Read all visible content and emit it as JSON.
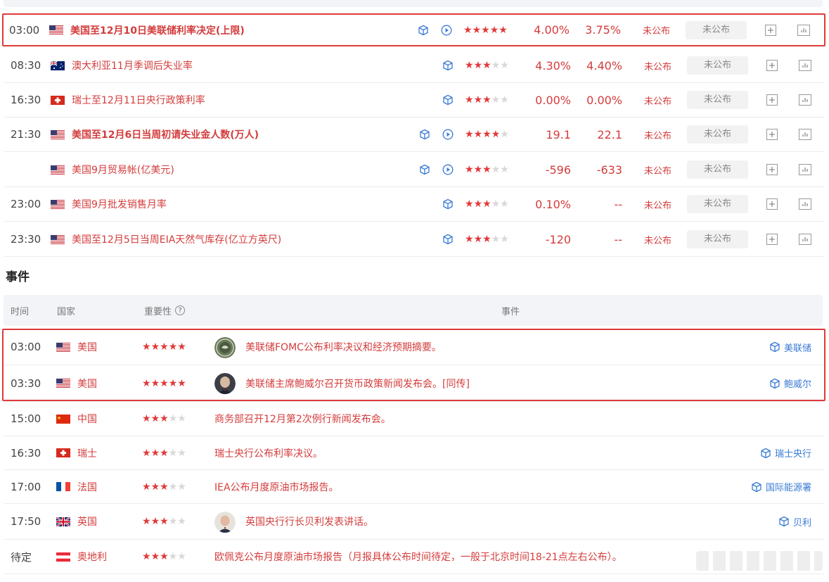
{
  "data_rows": [
    {
      "time": "03:00",
      "flag": "us",
      "name": "美国至12月10日美联储利率决定(上限)",
      "bold": true,
      "cube": true,
      "play": true,
      "stars": 5,
      "previous": "4.00%",
      "forecast": "3.75%",
      "status": "未公布",
      "actual": "未公布",
      "highlight": true
    },
    {
      "time": "08:30",
      "flag": "au",
      "name": "澳大利亚11月季调后失业率",
      "bold": false,
      "cube": true,
      "play": false,
      "stars": 3,
      "previous": "4.30%",
      "forecast": "4.40%",
      "status": "未公布",
      "actual": "未公布",
      "highlight": false
    },
    {
      "time": "16:30",
      "flag": "ch",
      "name": "瑞士至12月11日央行政策利率",
      "bold": false,
      "cube": true,
      "play": false,
      "stars": 3,
      "previous": "0.00%",
      "forecast": "0.00%",
      "status": "未公布",
      "actual": "未公布",
      "highlight": false
    },
    {
      "time": "21:30",
      "flag": "us",
      "name": "美国至12月6日当周初请失业金人数(万人)",
      "bold": true,
      "cube": true,
      "play": true,
      "stars": 4,
      "previous": "19.1",
      "forecast": "22.1",
      "status": "未公布",
      "actual": "未公布",
      "highlight": false
    },
    {
      "time": "",
      "flag": "us",
      "name": "美国9月贸易帐(亿美元)",
      "bold": false,
      "cube": true,
      "play": true,
      "stars": 3,
      "previous": "-596",
      "forecast": "-633",
      "status": "未公布",
      "actual": "未公布",
      "highlight": false
    },
    {
      "time": "23:00",
      "flag": "us",
      "name": "美国9月批发销售月率",
      "bold": false,
      "cube": true,
      "play": false,
      "stars": 3,
      "previous": "0.10%",
      "forecast": "--",
      "status": "未公布",
      "actual": "未公布",
      "highlight": false
    },
    {
      "time": "23:30",
      "flag": "us",
      "name": "美国至12月5日当周EIA天然气库存(亿立方英尺)",
      "bold": false,
      "cube": true,
      "play": false,
      "stars": 3,
      "previous": "-120",
      "forecast": "--",
      "status": "未公布",
      "actual": "未公布",
      "highlight": false
    }
  ],
  "events_section": {
    "title": "事件",
    "headers": {
      "time": "时间",
      "country": "国家",
      "importance": "重要性",
      "importance_help": "?",
      "event": "事件"
    }
  },
  "event_rows": [
    {
      "time": "03:00",
      "flag": "us",
      "country": "美国",
      "stars": 5,
      "avatar": "fed-seal",
      "text": "美联储FOMC公布利率决议和经济预期摘要。",
      "tag": "美联储"
    },
    {
      "time": "03:30",
      "flag": "us",
      "country": "美国",
      "stars": 5,
      "avatar": "powell",
      "text": "美联储主席鲍威尔召开货币政策新闻发布会。[同传]",
      "tag": "鲍威尔"
    },
    {
      "time": "15:00",
      "flag": "cn",
      "country": "中国",
      "stars": 3,
      "avatar": "",
      "text": "商务部召开12月第2次例行新闻发布会。",
      "tag": ""
    },
    {
      "time": "16:30",
      "flag": "ch",
      "country": "瑞士",
      "stars": 3,
      "avatar": "",
      "text": "瑞士央行公布利率决议。",
      "tag": "瑞士央行"
    },
    {
      "time": "17:00",
      "flag": "fr",
      "country": "法国",
      "stars": 3,
      "avatar": "",
      "text": "IEA公布月度原油市场报告。",
      "tag": "国际能源署"
    },
    {
      "time": "17:50",
      "flag": "gb",
      "country": "英国",
      "stars": 3,
      "avatar": "bailey",
      "text": "英国央行行长贝利发表讲话。",
      "tag": "贝利"
    },
    {
      "time": "待定",
      "flag": "at",
      "country": "奥地利",
      "stars": 3,
      "avatar": "",
      "text": "欧佩克公布月度原油市场报告（月报具体公布时间待定，一般于北京时间18-21点左右公布）。",
      "tag": ""
    }
  ],
  "icons": {
    "cube": "cube-icon",
    "play": "play-circle-icon",
    "plus": "plus-box-icon",
    "chart": "bar-chart-icon",
    "help": "question-circle-icon"
  },
  "colors": {
    "accent_red": "#d43c3c",
    "highlight_border": "#e03a3a",
    "link_blue": "#3a7bd5",
    "star_off": "#d8d8d8"
  }
}
